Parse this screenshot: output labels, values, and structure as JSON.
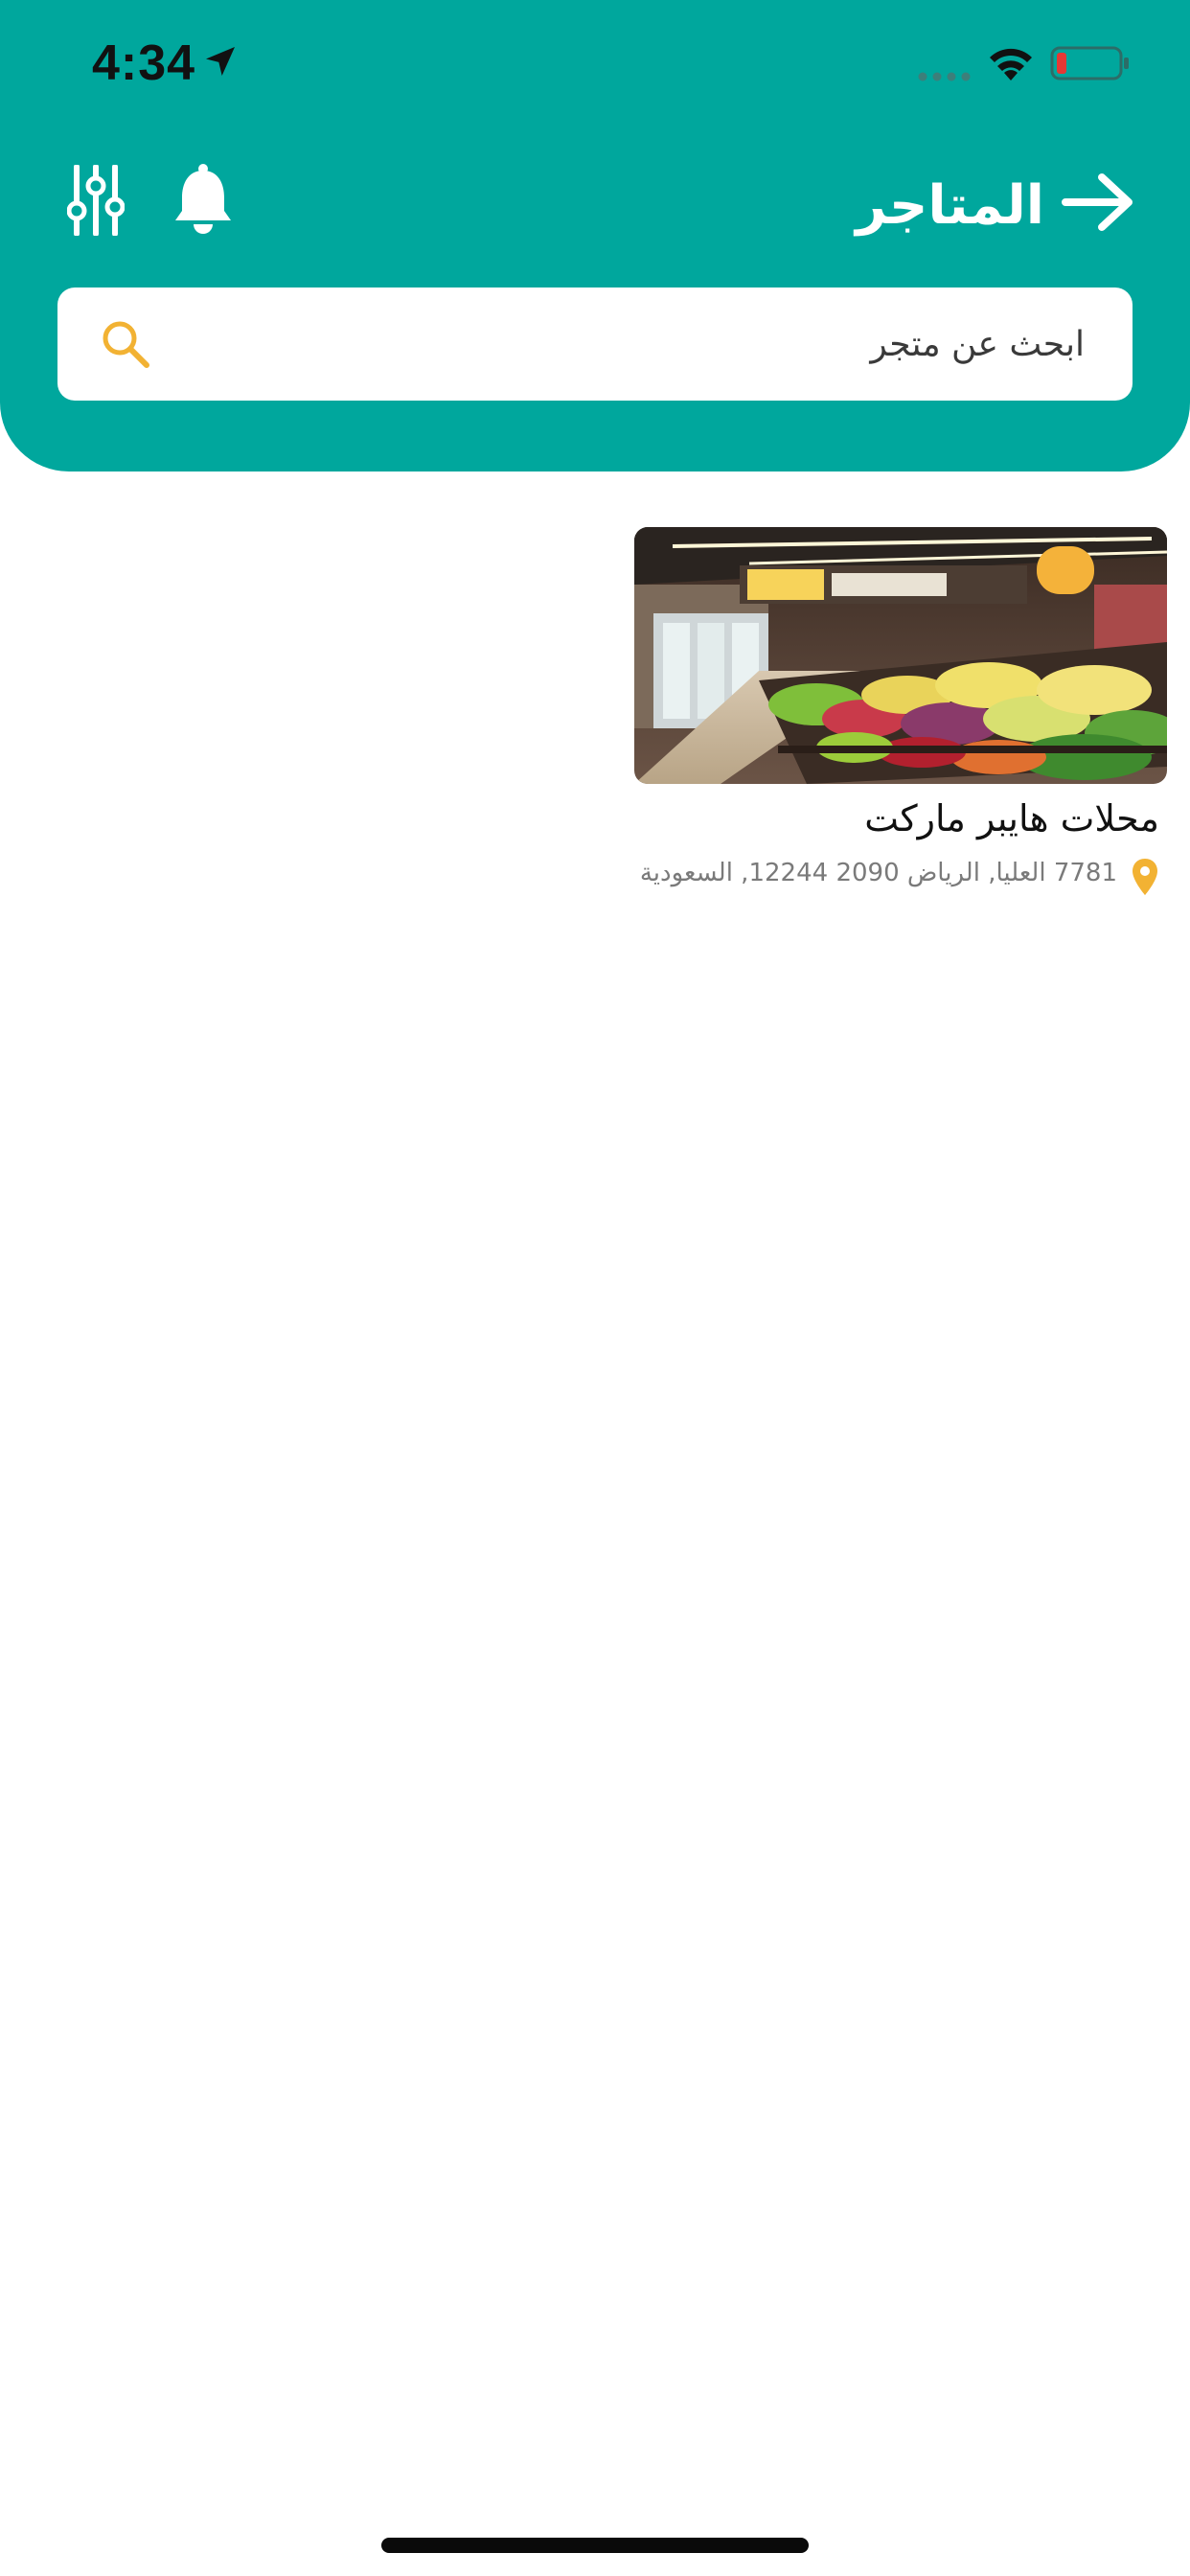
{
  "status_bar": {
    "time": "4:34",
    "icons": [
      "location-arrow-icon",
      "signal-icon",
      "wifi-icon",
      "battery-icon"
    ]
  },
  "header": {
    "title": "المتاجر",
    "back_icon": "arrow-right-icon",
    "notification_icon": "bell-icon",
    "filter_icon": "sliders-icon"
  },
  "search": {
    "placeholder": "ابحث عن متجر",
    "icon": "search-icon"
  },
  "stores": [
    {
      "name": "محلات هايبر ماركت",
      "address": "7781 العليا, الرياض 2090 12244, السعودية",
      "image": "supermarket-produce-aisle",
      "location_icon": "map-pin-icon"
    }
  ],
  "colors": {
    "primary": "#00a79d",
    "accent": "#f2b233",
    "battery_low": "#e53935"
  }
}
